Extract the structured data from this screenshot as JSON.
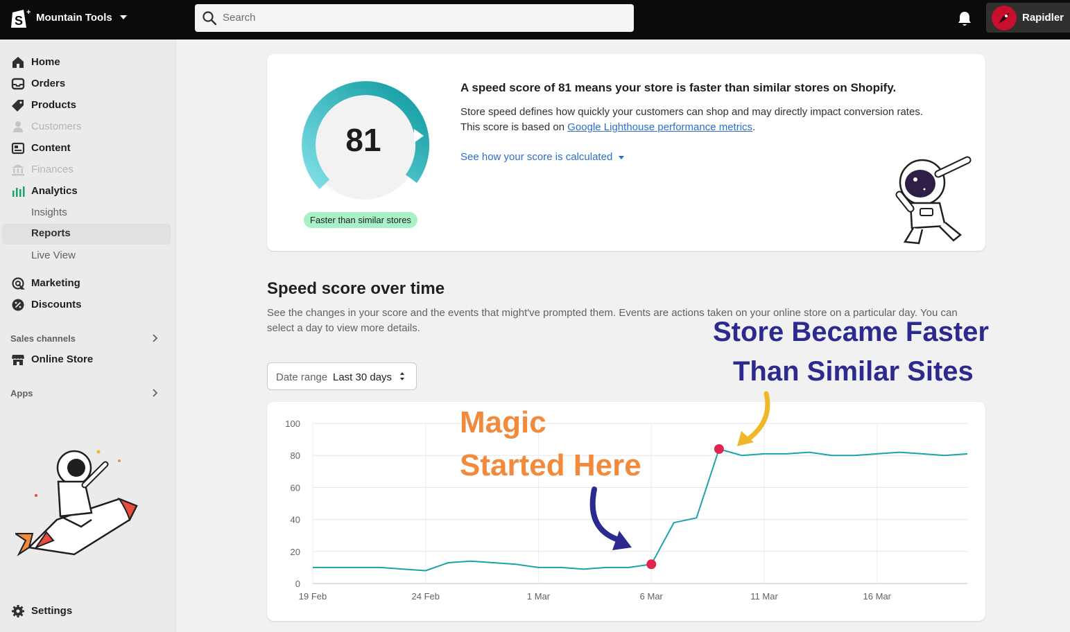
{
  "topbar": {
    "store_name": "Mountain Tools",
    "search_placeholder": "Search",
    "user_name": "Rapidler"
  },
  "sidebar": {
    "items": [
      {
        "label": "Home",
        "icon": "home-icon",
        "state": "normal"
      },
      {
        "label": "Orders",
        "icon": "orders-icon",
        "state": "normal"
      },
      {
        "label": "Products",
        "icon": "tag-icon",
        "state": "normal"
      },
      {
        "label": "Customers",
        "icon": "person-icon",
        "state": "disabled"
      },
      {
        "label": "Content",
        "icon": "content-icon",
        "state": "normal"
      },
      {
        "label": "Finances",
        "icon": "bank-icon",
        "state": "disabled"
      },
      {
        "label": "Analytics",
        "icon": "bar-chart-icon",
        "state": "normal"
      },
      {
        "label": "Insights",
        "icon": "",
        "state": "sub"
      },
      {
        "label": "Reports",
        "icon": "",
        "state": "active"
      },
      {
        "label": "Live View",
        "icon": "",
        "state": "sub"
      },
      {
        "label": "Marketing",
        "icon": "target-icon",
        "state": "normal"
      },
      {
        "label": "Discounts",
        "icon": "discount-icon",
        "state": "normal"
      }
    ],
    "sales_channels_label": "Sales channels",
    "online_store_label": "Online Store",
    "apps_label": "Apps",
    "settings_label": "Settings"
  },
  "speed_card": {
    "score": "81",
    "badge": "Faster than similar stores",
    "heading": "A speed score of 81 means your store is faster than similar stores on Shopify.",
    "para_1": "Store speed defines how quickly your customers can shop and may directly impact conversion rates.",
    "para_2_prefix": "This score is based on ",
    "para_2_link": "Google Lighthouse performance metrics",
    "para_2_suffix": ".",
    "see_how_link": "See how your score is calculated"
  },
  "over_time": {
    "title": "Speed score over time",
    "description": "See the changes in your score and the events that might've prompted them. Events are actions taken on your online store on a particular day. You can select a day to view more details.",
    "date_range_label": "Date range",
    "date_range_value": "Last 30 days"
  },
  "annotations": {
    "blue_line_1": "Store Became Faster",
    "blue_line_2": "Than Similar Sites",
    "orange_line_1": "Magic",
    "orange_line_2": "Started Here"
  },
  "colors": {
    "line": "#1aa3a8",
    "marker": "#e0234f",
    "annotation_blue": "#2d2a8f",
    "annotation_orange": "#f28a3b",
    "arrow_yellow": "#f0b72b"
  },
  "chart_data": {
    "type": "line",
    "x": [
      "19 Feb",
      "20 Feb",
      "21 Feb",
      "22 Feb",
      "23 Feb",
      "24 Feb",
      "25 Feb",
      "26 Feb",
      "27 Feb",
      "28 Feb",
      "1 Mar",
      "2 Mar",
      "3 Mar",
      "4 Mar",
      "5 Mar",
      "6 Mar",
      "7 Mar",
      "8 Mar",
      "9 Mar",
      "10 Mar",
      "11 Mar",
      "12 Mar",
      "13 Mar",
      "14 Mar",
      "15 Mar",
      "16 Mar",
      "17 Mar",
      "18 Mar",
      "19 Mar",
      "20 Mar"
    ],
    "series": [
      {
        "values": [
          10,
          10,
          10,
          10,
          9,
          8,
          13,
          14,
          13,
          12,
          10,
          10,
          9,
          10,
          10,
          12,
          38,
          41,
          84,
          80,
          81,
          81,
          82,
          80,
          80,
          81,
          82,
          81,
          80,
          81
        ]
      }
    ],
    "x_tick_labels": [
      "19 Feb",
      "24 Feb",
      "1 Mar",
      "6 Mar",
      "11 Mar",
      "16 Mar"
    ],
    "y_tick_labels": [
      0,
      20,
      40,
      60,
      80,
      100
    ],
    "ylim": [
      0,
      100
    ],
    "highlighted_points": [
      "6 Mar",
      "9 Mar"
    ],
    "grid": true
  }
}
